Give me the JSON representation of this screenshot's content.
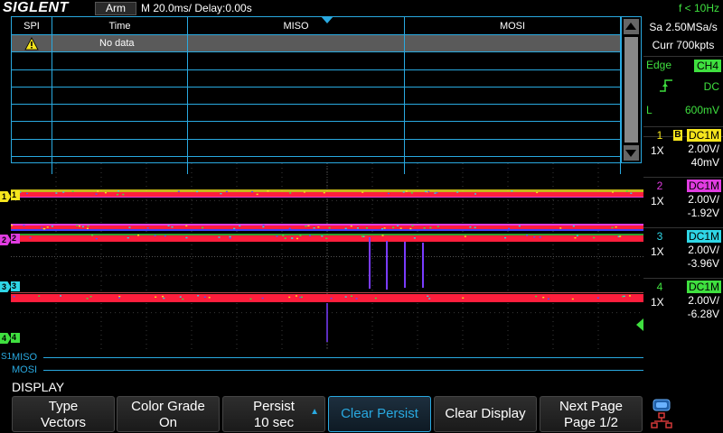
{
  "topbar": {
    "brand": "SIGLENT",
    "trigger_state": "Arm",
    "timebase": "M 20.0ms/ Delay:0.00s",
    "frequency": "f < 10Hz"
  },
  "acquisition": {
    "sample_rate": "Sa 2.50MSa/s",
    "memory": "Curr 700kpts"
  },
  "trigger": {
    "type": "Edge",
    "source": "CH4",
    "coupling": "DC",
    "level_label": "L",
    "level": "600mV",
    "slope_icon": "rising-edge-icon"
  },
  "channels": [
    {
      "num": "1",
      "bw": "B",
      "coupling": "DC1M",
      "probe": "1X",
      "scale": "2.00V/",
      "offset": "40mV",
      "color": "#f5e51d"
    },
    {
      "num": "2",
      "bw": "",
      "coupling": "DC1M",
      "probe": "1X",
      "scale": "2.00V/",
      "offset": "-1.92V",
      "color": "#e03ce0"
    },
    {
      "num": "3",
      "bw": "",
      "coupling": "DC1M",
      "probe": "1X",
      "scale": "2.00V/",
      "offset": "-3.96V",
      "color": "#2fd6e6"
    },
    {
      "num": "4",
      "bw": "",
      "coupling": "DC1M",
      "probe": "1X",
      "scale": "2.00V/",
      "offset": "-6.28V",
      "color": "#3fe03f"
    }
  ],
  "decode_table": {
    "headers": [
      "SPI",
      "Time",
      "MISO",
      "MOSI"
    ],
    "first_row": {
      "icon": "warning-icon",
      "time": "No data"
    }
  },
  "bus": {
    "marker": "S1",
    "miso_label": "MISO",
    "mosi_label": "MOSI"
  },
  "menu": {
    "title": "DISPLAY",
    "softkeys": [
      {
        "line1": "Type",
        "line2": "Vectors"
      },
      {
        "line1": "Color Grade",
        "line2": "On"
      },
      {
        "line1": "Persist",
        "line2": "10 sec"
      },
      {
        "line1": "Clear Persist",
        "line2": ""
      },
      {
        "line1": "Clear Display",
        "line2": ""
      },
      {
        "line1": "Next Page",
        "line2": "Page 1/2"
      }
    ]
  },
  "colors": {
    "accent": "#29a9e0",
    "grid": "#3a3a3a",
    "persist_red": "#ff1e3c"
  }
}
